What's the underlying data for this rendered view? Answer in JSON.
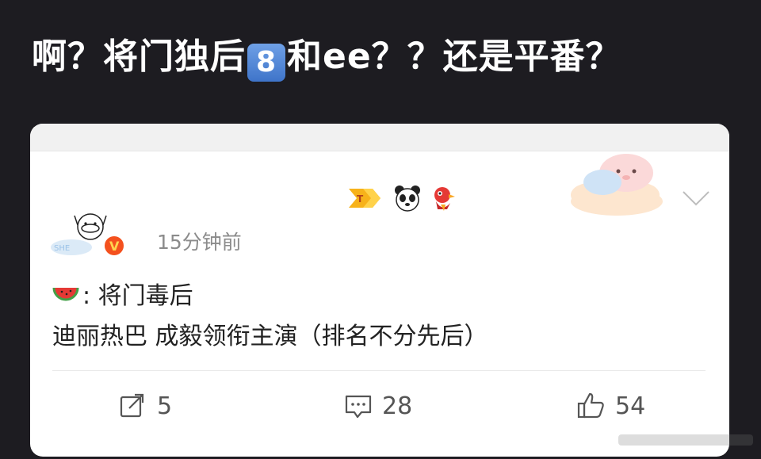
{
  "headline": {
    "part1": "啊？将门独后",
    "badge": "8",
    "part2": "和ee？？还是平番？"
  },
  "post": {
    "time": "15分钟前",
    "line1_text": ": 将门毒后",
    "line2_text": "迪丽热巴 成毅领衔主演（排名不分先后）",
    "actions": {
      "repost_count": "5",
      "comment_count": "28",
      "like_count": "54"
    }
  },
  "icons": {
    "level": "chevron-badge-icon",
    "panda": "panda-icon",
    "bird": "bird-icon",
    "verified": "verified-v-icon",
    "watermelon": "watermelon-icon",
    "repost": "repost-icon",
    "comment": "comment-icon",
    "like": "thumbs-up-icon",
    "menu": "chevron-down-icon"
  },
  "colors": {
    "background": "#1d1c21",
    "card": "#ffffff",
    "verified": "#f4511e",
    "text_primary": "#222222",
    "text_secondary": "#8b8b8b"
  }
}
